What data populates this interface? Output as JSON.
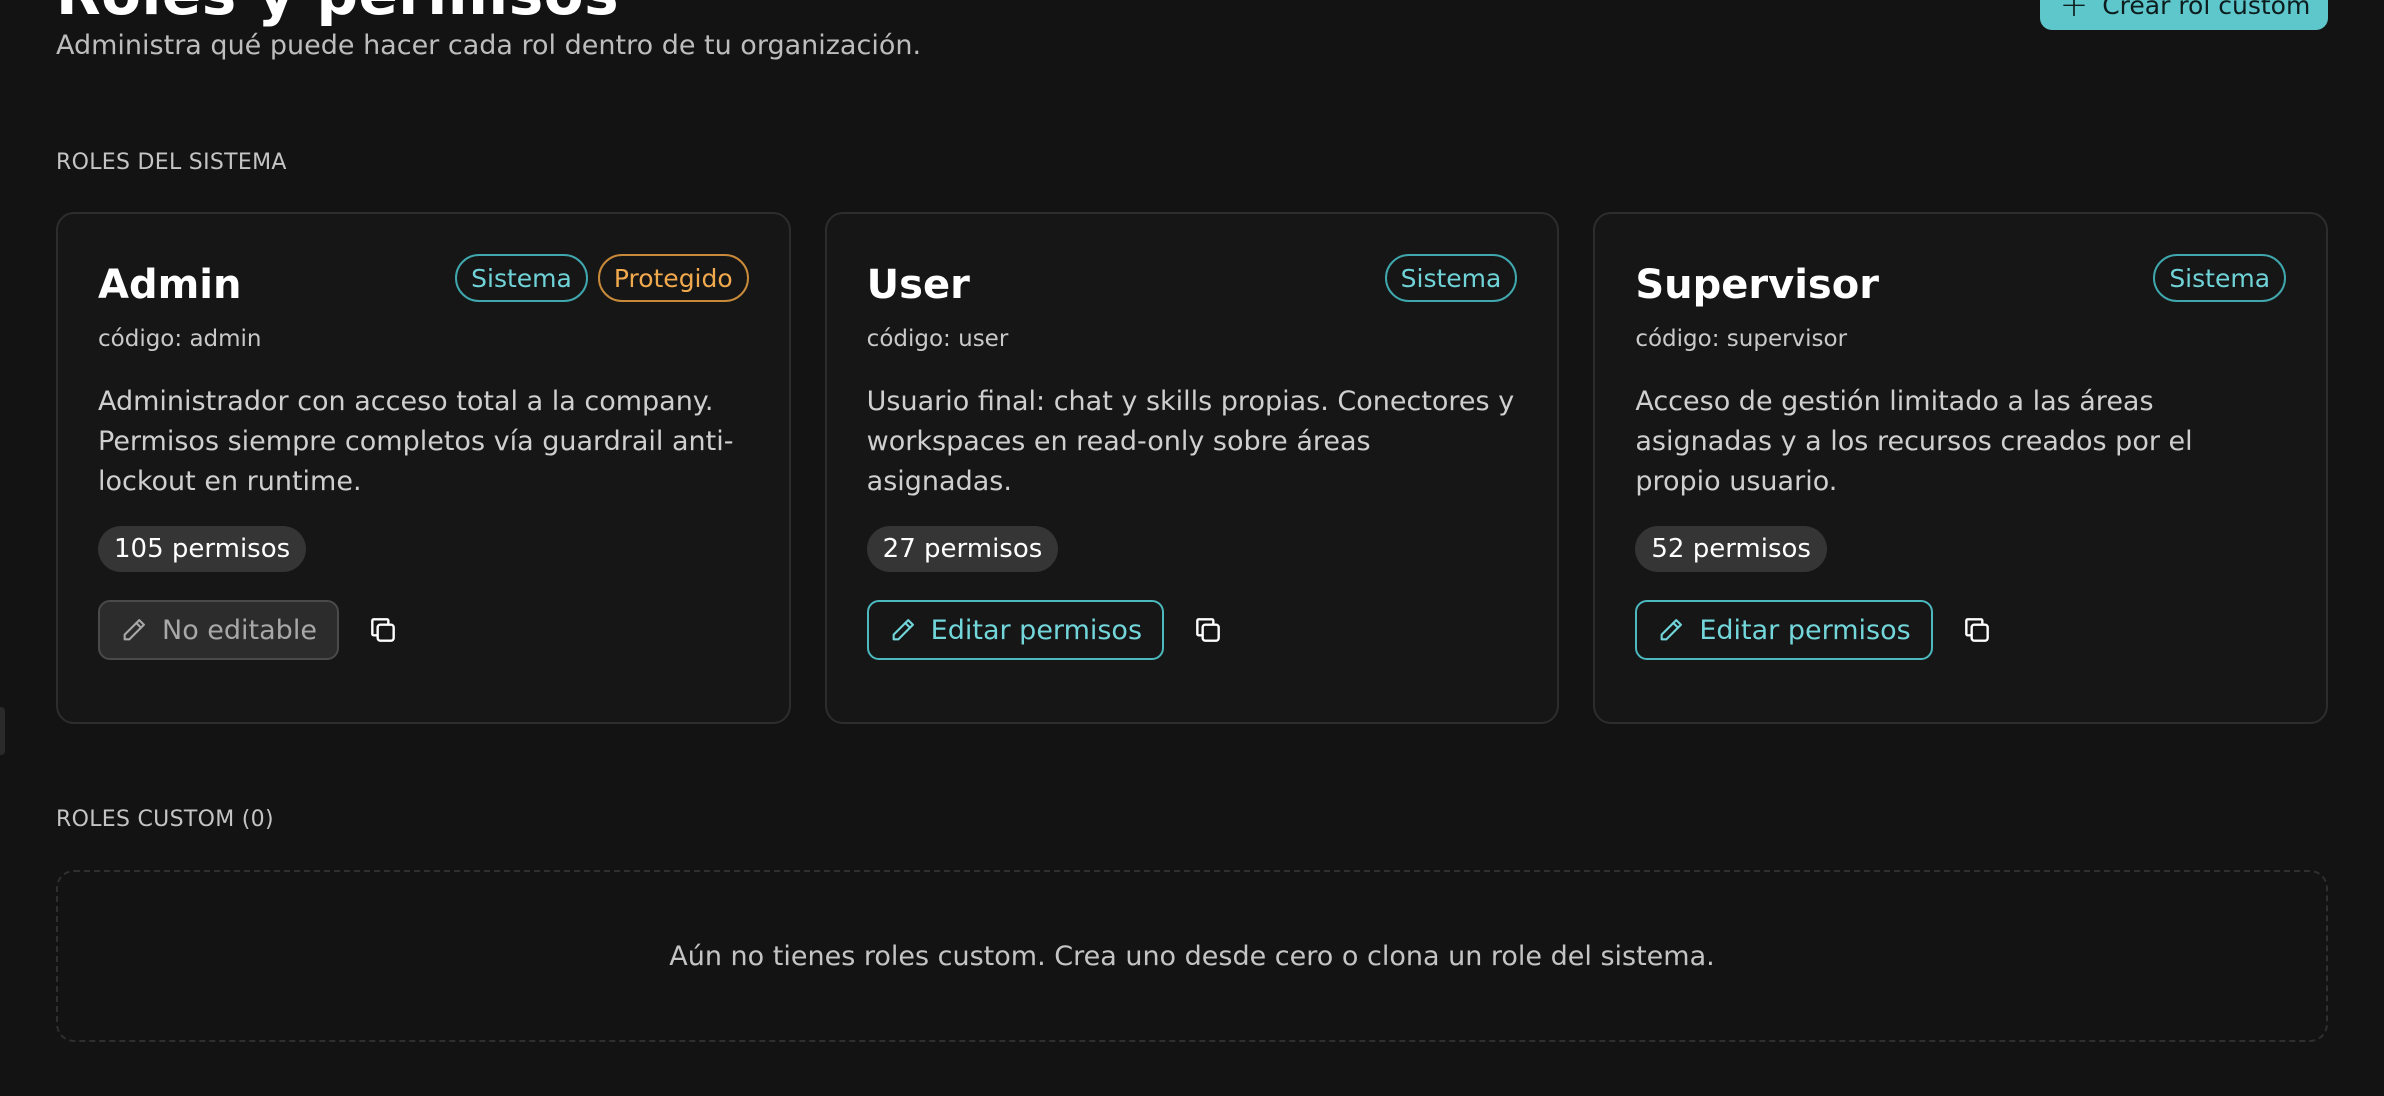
{
  "header": {
    "title": "Roles y permisos",
    "subtitle": "Administra qué puede hacer cada rol dentro de tu organización.",
    "create_button": "Crear rol custom"
  },
  "sections": {
    "system": "ROLES DEL SISTEMA",
    "custom": "ROLES CUSTOM (0)"
  },
  "roles": [
    {
      "name": "Admin",
      "badges": [
        "Sistema",
        "Protegido"
      ],
      "code": "código: admin",
      "description": "Administrador con acceso total a la company. Permisos siempre completos vía guardrail anti-lockout en runtime.",
      "permissions": "105 permisos",
      "edit_label": "No editable",
      "editable": false
    },
    {
      "name": "User",
      "badges": [
        "Sistema"
      ],
      "code": "código: user",
      "description": "Usuario final: chat y skills propias. Conectores y workspaces en read-only sobre áreas asignadas.",
      "permissions": "27 permisos",
      "edit_label": "Editar permisos",
      "editable": true
    },
    {
      "name": "Supervisor",
      "badges": [
        "Sistema"
      ],
      "code": "código: supervisor",
      "description": "Acceso de gestión limitado a las áreas asignadas y a los recursos creados por el propio usuario.",
      "permissions": "52 permisos",
      "edit_label": "Editar permisos",
      "editable": true
    }
  ],
  "empty_state": {
    "text": "Aún no tienes roles custom. Crea uno desde cero o clona un role del sistema."
  },
  "colors": {
    "background": "#131313",
    "accent": "#5ec7cc",
    "badge_sistema": "#6fd3d8",
    "badge_protegido": "#f0a94d"
  },
  "icons": {
    "create": "plus-icon",
    "edit": "pencil-icon",
    "clone": "copy-icon"
  }
}
